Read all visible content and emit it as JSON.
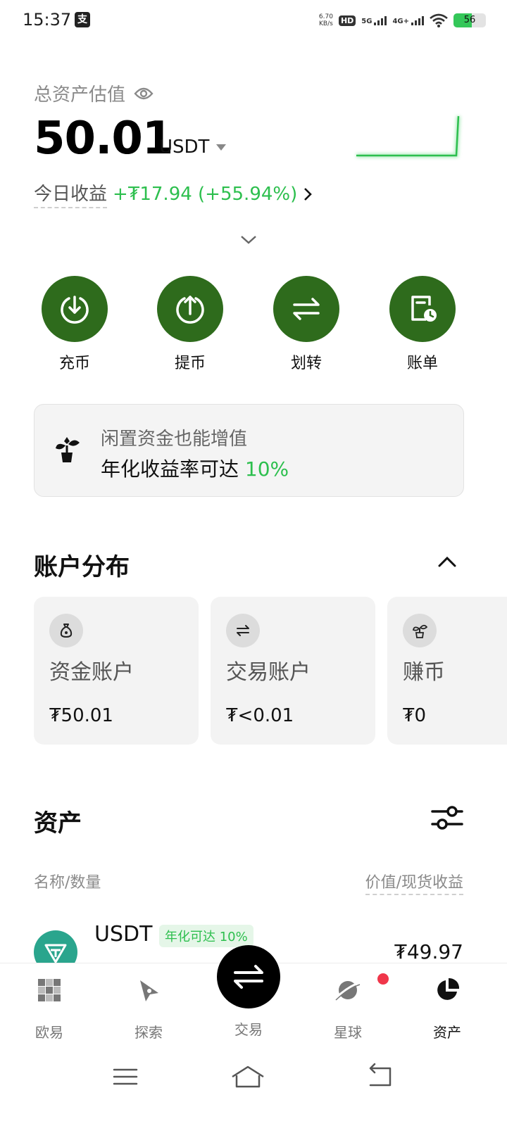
{
  "status": {
    "time": "15:37",
    "pay_glyph": "支",
    "speed_value": "6.70",
    "speed_unit": "KB/s",
    "hd": "HD",
    "net1": "5G",
    "net2": "4G+",
    "battery": "56",
    "battery_level": 56
  },
  "summary": {
    "label": "总资产估值",
    "amount": "50.01",
    "unit": "USDT",
    "today_label": "今日收益",
    "today_value": "+₮17.94 (+55.94%)"
  },
  "actions": [
    {
      "label": "充币",
      "icon": "deposit-icon"
    },
    {
      "label": "提币",
      "icon": "withdraw-icon"
    },
    {
      "label": "划转",
      "icon": "transfer-icon"
    },
    {
      "label": "账单",
      "icon": "bill-icon"
    }
  ],
  "promo": {
    "line1": "闲置资金也能增值",
    "line2_prefix": "年化收益率可达 ",
    "line2_highlight": "10%"
  },
  "distribution": {
    "title": "账户分布",
    "accounts": [
      {
        "name": "资金账户",
        "value": "₮50.01",
        "icon": "money-bag-icon"
      },
      {
        "name": "交易账户",
        "value": "₮<0.01",
        "icon": "swap-icon"
      },
      {
        "name": "赚币",
        "value": "₮0",
        "icon": "sprout-icon"
      }
    ]
  },
  "assets": {
    "title": "资产",
    "col_left": "名称/数量",
    "col_right": "价值/现货收益",
    "items": [
      {
        "name": "USDT",
        "badge": "年化可达 10%",
        "value": "₮49.97"
      }
    ]
  },
  "nav": {
    "items": [
      "欧易",
      "探索",
      "交易",
      "星球",
      "资产"
    ],
    "active": "资产"
  },
  "colors": {
    "accent_green": "#2e6b1c",
    "profit_green": "#2dbf4e",
    "tether": "#2aa58d",
    "badge_red": "#f0364a"
  }
}
